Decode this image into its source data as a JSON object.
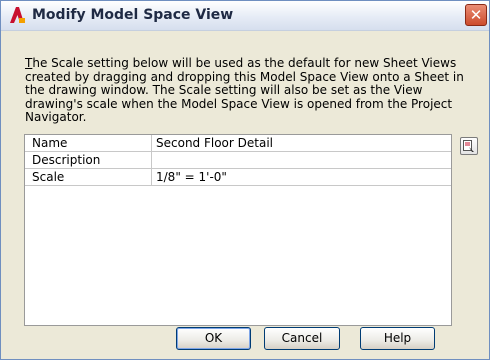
{
  "window": {
    "title": "Modify Model Space View",
    "close_glyph": "✕",
    "app_icon": "autocad-a-icon"
  },
  "description": {
    "first_letter": "T",
    "text_rest": "he Scale setting below will be used as the default for new Sheet Views created by dragging and dropping this Model Space View onto a Sheet in the drawing window. The Scale setting will also be set as the View drawing's scale when the Model Space View is opened from the Project Navigator."
  },
  "properties": [
    {
      "name": "Name",
      "value": "Second Floor Detail"
    },
    {
      "name": "Description",
      "value": ""
    },
    {
      "name": "Scale",
      "value": "1/8\" = 1'-0\""
    }
  ],
  "side_button_icon": "edit-properties-icon",
  "buttons": {
    "ok": "OK",
    "cancel": "Cancel",
    "help": "Help"
  },
  "colors": {
    "dialog_bg": "#ece9d8",
    "close_button": "#cc4b2c",
    "app_icon_red": "#c8102e"
  }
}
